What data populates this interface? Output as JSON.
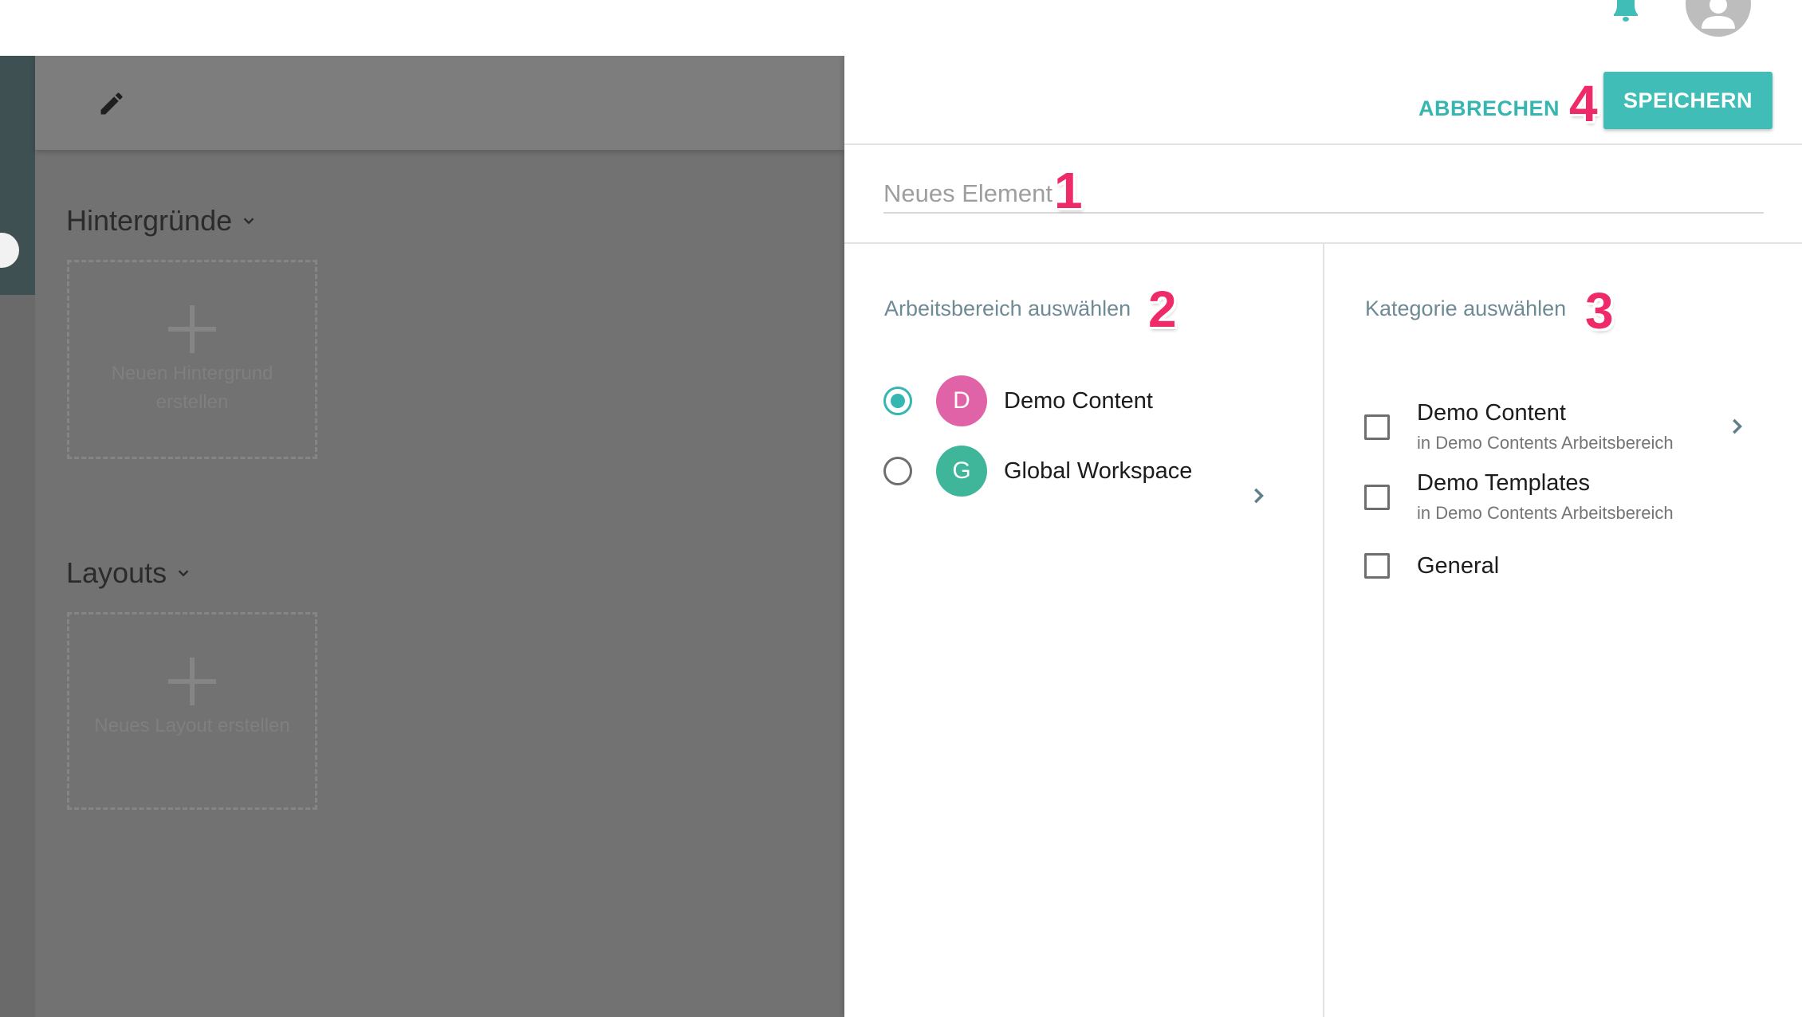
{
  "colors": {
    "accent": "#3fbdb6",
    "annotation": "#ee2a68",
    "avatar_d": "#e063a8",
    "avatar_g": "#3fb69a",
    "dim_overlay": "#727272"
  },
  "topbar": {
    "notification_icon": "bell-icon",
    "user_icon": "account-icon"
  },
  "background": {
    "edit_icon": "pencil-icon",
    "sections": [
      {
        "title": "Hintergründe",
        "create_label": "Neuen Hintergrund erstellen"
      },
      {
        "title": "Layouts",
        "create_label": "Neues Layout erstellen"
      }
    ]
  },
  "panel": {
    "cancel_label": "ABBRECHEN",
    "save_label": "SPEICHERN",
    "name_placeholder": "Neues Element",
    "workspace": {
      "label": "Arbeitsbereich auswählen",
      "items": [
        {
          "initial": "D",
          "name": "Demo Content",
          "selected": true,
          "has_children": false
        },
        {
          "initial": "G",
          "name": "Global Workspace",
          "selected": false,
          "has_children": true
        }
      ]
    },
    "category": {
      "label": "Kategorie auswählen",
      "items": [
        {
          "name": "Demo Content",
          "subtitle": "in Demo Contents Arbeitsbereich",
          "checked": false,
          "has_children": true
        },
        {
          "name": "Demo Templates",
          "subtitle": "in Demo Contents Arbeitsbereich",
          "checked": false,
          "has_children": false
        },
        {
          "name": "General",
          "subtitle": "",
          "checked": false,
          "has_children": false
        }
      ]
    }
  },
  "annotations": [
    "1",
    "2",
    "3",
    "4"
  ]
}
